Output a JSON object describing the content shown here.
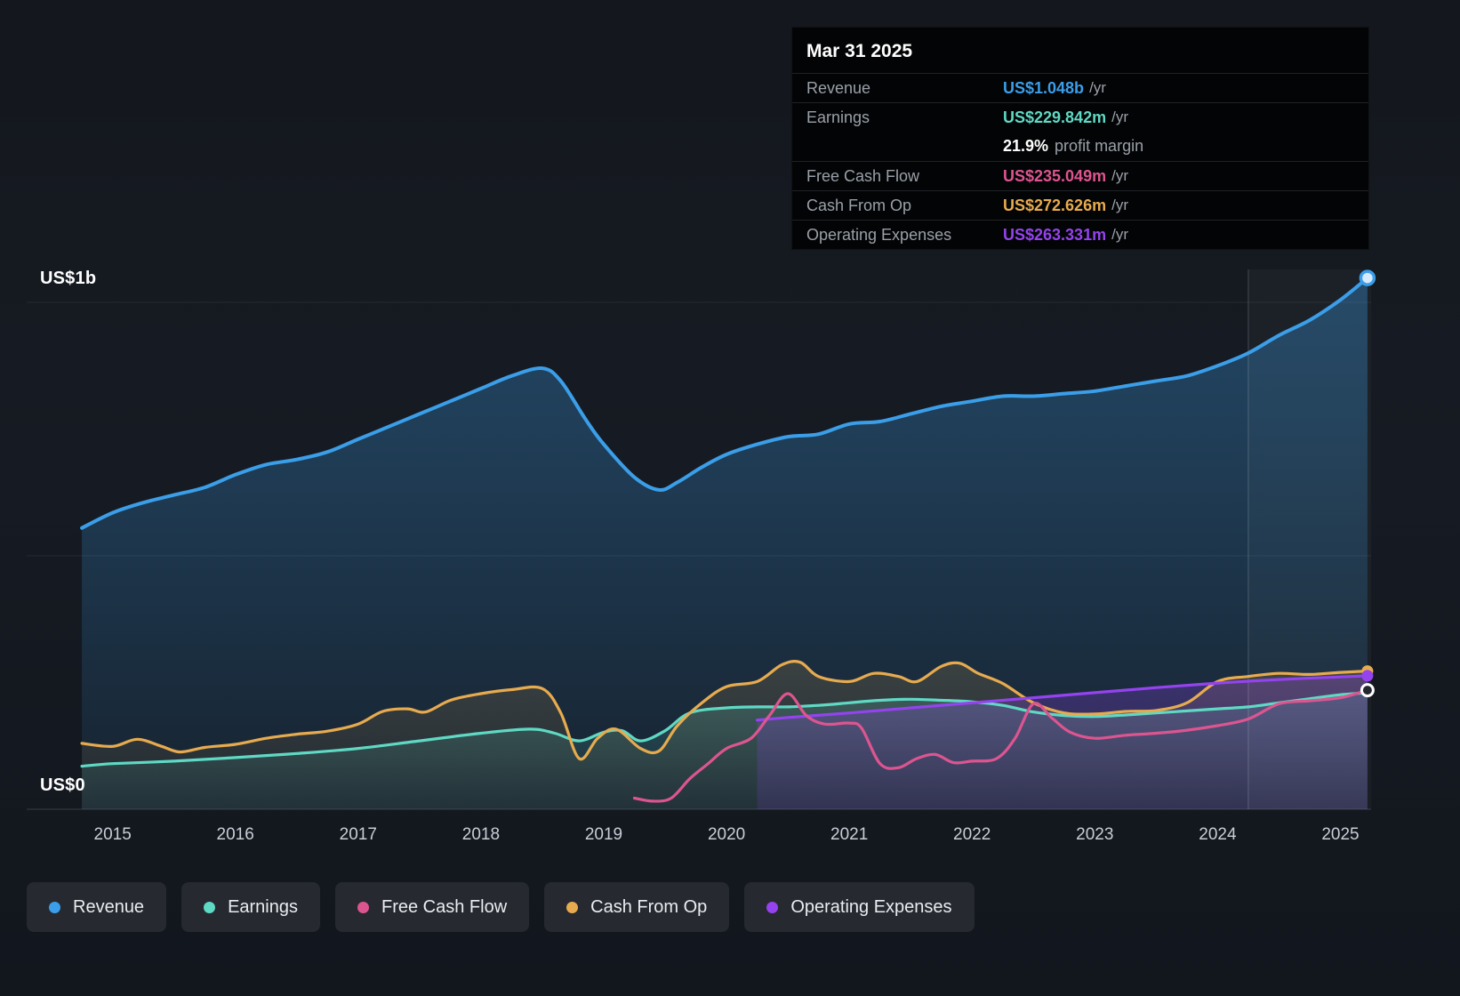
{
  "tooltip": {
    "date": "Mar 31 2025",
    "rows": [
      {
        "label": "Revenue",
        "value": "US$1.048b",
        "suffix": "/yr",
        "color": "#3b9ee9"
      },
      {
        "label": "Earnings",
        "value": "US$229.842m",
        "suffix": "/yr",
        "color": "#5fd9c4",
        "sub_value": "21.9%",
        "sub_text": "profit margin"
      },
      {
        "label": "Free Cash Flow",
        "value": "US$235.049m",
        "suffix": "/yr",
        "color": "#dd5590"
      },
      {
        "label": "Cash From Op",
        "value": "US$272.626m",
        "suffix": "/yr",
        "color": "#e7ab4f"
      },
      {
        "label": "Operating Expenses",
        "value": "US$263.331m",
        "suffix": "/yr",
        "color": "#9443ee"
      }
    ]
  },
  "legend": {
    "items": [
      {
        "label": "Revenue",
        "color": "#3b9ee9"
      },
      {
        "label": "Earnings",
        "color": "#5fd9c4"
      },
      {
        "label": "Free Cash Flow",
        "color": "#dd5590"
      },
      {
        "label": "Cash From Op",
        "color": "#e7ab4f"
      },
      {
        "label": "Operating Expenses",
        "color": "#9443ee"
      }
    ]
  },
  "chart_data": {
    "type": "area",
    "unit": "US$ billions",
    "y_top_label": "US$1b",
    "y_bottom_label": "US$0",
    "x_ticks": [
      2015,
      2016,
      2017,
      2018,
      2019,
      2020,
      2021,
      2022,
      2023,
      2024,
      2025
    ],
    "x_range": [
      2014.3,
      2025.25
    ],
    "y_range": [
      0,
      1.1
    ],
    "y_gridlines": [
      0,
      0.5,
      1.0
    ],
    "highlight_band_start": 2024.25,
    "series": [
      {
        "name": "Revenue",
        "color": "#3b9ee9",
        "fill": true,
        "marker": "ring",
        "points": [
          [
            2014.75,
            0.555
          ],
          [
            2015,
            0.585
          ],
          [
            2015.25,
            0.605
          ],
          [
            2015.5,
            0.62
          ],
          [
            2015.75,
            0.635
          ],
          [
            2016,
            0.66
          ],
          [
            2016.25,
            0.68
          ],
          [
            2016.5,
            0.69
          ],
          [
            2016.75,
            0.705
          ],
          [
            2017,
            0.73
          ],
          [
            2017.25,
            0.755
          ],
          [
            2017.5,
            0.78
          ],
          [
            2017.75,
            0.805
          ],
          [
            2018,
            0.83
          ],
          [
            2018.25,
            0.855
          ],
          [
            2018.5,
            0.87
          ],
          [
            2018.65,
            0.845
          ],
          [
            2018.85,
            0.77
          ],
          [
            2019,
            0.72
          ],
          [
            2019.25,
            0.655
          ],
          [
            2019.45,
            0.63
          ],
          [
            2019.6,
            0.645
          ],
          [
            2019.8,
            0.675
          ],
          [
            2020,
            0.7
          ],
          [
            2020.25,
            0.72
          ],
          [
            2020.5,
            0.735
          ],
          [
            2020.75,
            0.74
          ],
          [
            2021,
            0.76
          ],
          [
            2021.25,
            0.765
          ],
          [
            2021.5,
            0.78
          ],
          [
            2021.75,
            0.795
          ],
          [
            2022,
            0.805
          ],
          [
            2022.25,
            0.815
          ],
          [
            2022.5,
            0.815
          ],
          [
            2022.75,
            0.82
          ],
          [
            2023,
            0.825
          ],
          [
            2023.25,
            0.835
          ],
          [
            2023.5,
            0.845
          ],
          [
            2023.75,
            0.855
          ],
          [
            2024,
            0.875
          ],
          [
            2024.25,
            0.9
          ],
          [
            2024.5,
            0.935
          ],
          [
            2024.75,
            0.965
          ],
          [
            2025,
            1.005
          ],
          [
            2025.22,
            1.048
          ]
        ]
      },
      {
        "name": "Earnings",
        "color": "#5fd9c4",
        "fill": true,
        "marker": "none",
        "points": [
          [
            2014.75,
            0.085
          ],
          [
            2015,
            0.09
          ],
          [
            2015.5,
            0.095
          ],
          [
            2016,
            0.102
          ],
          [
            2016.5,
            0.11
          ],
          [
            2017,
            0.12
          ],
          [
            2017.5,
            0.135
          ],
          [
            2018,
            0.15
          ],
          [
            2018.4,
            0.158
          ],
          [
            2018.6,
            0.15
          ],
          [
            2018.8,
            0.135
          ],
          [
            2019,
            0.152
          ],
          [
            2019.15,
            0.155
          ],
          [
            2019.3,
            0.135
          ],
          [
            2019.5,
            0.155
          ],
          [
            2019.7,
            0.19
          ],
          [
            2020,
            0.2
          ],
          [
            2020.25,
            0.202
          ],
          [
            2020.5,
            0.202
          ],
          [
            2020.75,
            0.205
          ],
          [
            2021,
            0.21
          ],
          [
            2021.25,
            0.215
          ],
          [
            2021.5,
            0.217
          ],
          [
            2021.75,
            0.215
          ],
          [
            2022,
            0.212
          ],
          [
            2022.25,
            0.205
          ],
          [
            2022.5,
            0.192
          ],
          [
            2022.75,
            0.185
          ],
          [
            2023,
            0.183
          ],
          [
            2023.25,
            0.186
          ],
          [
            2023.5,
            0.19
          ],
          [
            2023.75,
            0.194
          ],
          [
            2024,
            0.198
          ],
          [
            2024.25,
            0.202
          ],
          [
            2024.5,
            0.21
          ],
          [
            2024.75,
            0.218
          ],
          [
            2025,
            0.226
          ],
          [
            2025.22,
            0.2298
          ]
        ]
      },
      {
        "name": "Free Cash Flow",
        "color": "#dd5590",
        "fill": false,
        "marker": "ring-white",
        "points": [
          [
            2019.25,
            0.022
          ],
          [
            2019.4,
            0.016
          ],
          [
            2019.55,
            0.022
          ],
          [
            2019.7,
            0.06
          ],
          [
            2019.85,
            0.09
          ],
          [
            2020,
            0.12
          ],
          [
            2020.2,
            0.14
          ],
          [
            2020.35,
            0.185
          ],
          [
            2020.5,
            0.228
          ],
          [
            2020.65,
            0.185
          ],
          [
            2020.8,
            0.168
          ],
          [
            2021,
            0.17
          ],
          [
            2021.1,
            0.16
          ],
          [
            2021.25,
            0.09
          ],
          [
            2021.4,
            0.082
          ],
          [
            2021.55,
            0.1
          ],
          [
            2021.7,
            0.108
          ],
          [
            2021.85,
            0.092
          ],
          [
            2022,
            0.095
          ],
          [
            2022.2,
            0.1
          ],
          [
            2022.35,
            0.14
          ],
          [
            2022.5,
            0.208
          ],
          [
            2022.65,
            0.18
          ],
          [
            2022.8,
            0.152
          ],
          [
            2023,
            0.14
          ],
          [
            2023.25,
            0.146
          ],
          [
            2023.5,
            0.15
          ],
          [
            2023.75,
            0.156
          ],
          [
            2024,
            0.165
          ],
          [
            2024.25,
            0.178
          ],
          [
            2024.5,
            0.208
          ],
          [
            2024.75,
            0.214
          ],
          [
            2025,
            0.22
          ],
          [
            2025.22,
            0.235
          ]
        ]
      },
      {
        "name": "Cash From Op",
        "color": "#e7ab4f",
        "fill": true,
        "marker": "dot",
        "points": [
          [
            2014.75,
            0.13
          ],
          [
            2015,
            0.124
          ],
          [
            2015.2,
            0.138
          ],
          [
            2015.4,
            0.124
          ],
          [
            2015.55,
            0.113
          ],
          [
            2015.75,
            0.122
          ],
          [
            2016,
            0.128
          ],
          [
            2016.25,
            0.14
          ],
          [
            2016.5,
            0.148
          ],
          [
            2016.75,
            0.154
          ],
          [
            2017,
            0.168
          ],
          [
            2017.2,
            0.193
          ],
          [
            2017.4,
            0.198
          ],
          [
            2017.55,
            0.192
          ],
          [
            2017.75,
            0.215
          ],
          [
            2018,
            0.228
          ],
          [
            2018.25,
            0.236
          ],
          [
            2018.5,
            0.238
          ],
          [
            2018.65,
            0.19
          ],
          [
            2018.8,
            0.1
          ],
          [
            2018.95,
            0.14
          ],
          [
            2019.1,
            0.158
          ],
          [
            2019.3,
            0.12
          ],
          [
            2019.45,
            0.115
          ],
          [
            2019.6,
            0.165
          ],
          [
            2019.8,
            0.21
          ],
          [
            2020,
            0.242
          ],
          [
            2020.25,
            0.252
          ],
          [
            2020.45,
            0.285
          ],
          [
            2020.6,
            0.29
          ],
          [
            2020.75,
            0.262
          ],
          [
            2021,
            0.252
          ],
          [
            2021.2,
            0.268
          ],
          [
            2021.4,
            0.262
          ],
          [
            2021.55,
            0.252
          ],
          [
            2021.75,
            0.282
          ],
          [
            2021.9,
            0.288
          ],
          [
            2022.05,
            0.268
          ],
          [
            2022.25,
            0.248
          ],
          [
            2022.5,
            0.21
          ],
          [
            2022.75,
            0.19
          ],
          [
            2023,
            0.188
          ],
          [
            2023.25,
            0.193
          ],
          [
            2023.5,
            0.195
          ],
          [
            2023.75,
            0.21
          ],
          [
            2024,
            0.252
          ],
          [
            2024.25,
            0.262
          ],
          [
            2024.5,
            0.268
          ],
          [
            2024.75,
            0.266
          ],
          [
            2025,
            0.27
          ],
          [
            2025.22,
            0.2726
          ]
        ]
      },
      {
        "name": "Operating Expenses",
        "color": "#9443ee",
        "fill": true,
        "marker": "dot",
        "points": [
          [
            2020.25,
            0.176
          ],
          [
            2020.5,
            0.181
          ],
          [
            2021,
            0.19
          ],
          [
            2021.5,
            0.2
          ],
          [
            2022,
            0.21
          ],
          [
            2022.5,
            0.22
          ],
          [
            2023,
            0.23
          ],
          [
            2023.5,
            0.24
          ],
          [
            2024,
            0.249
          ],
          [
            2024.5,
            0.256
          ],
          [
            2025,
            0.261
          ],
          [
            2025.22,
            0.2633
          ]
        ]
      }
    ]
  }
}
